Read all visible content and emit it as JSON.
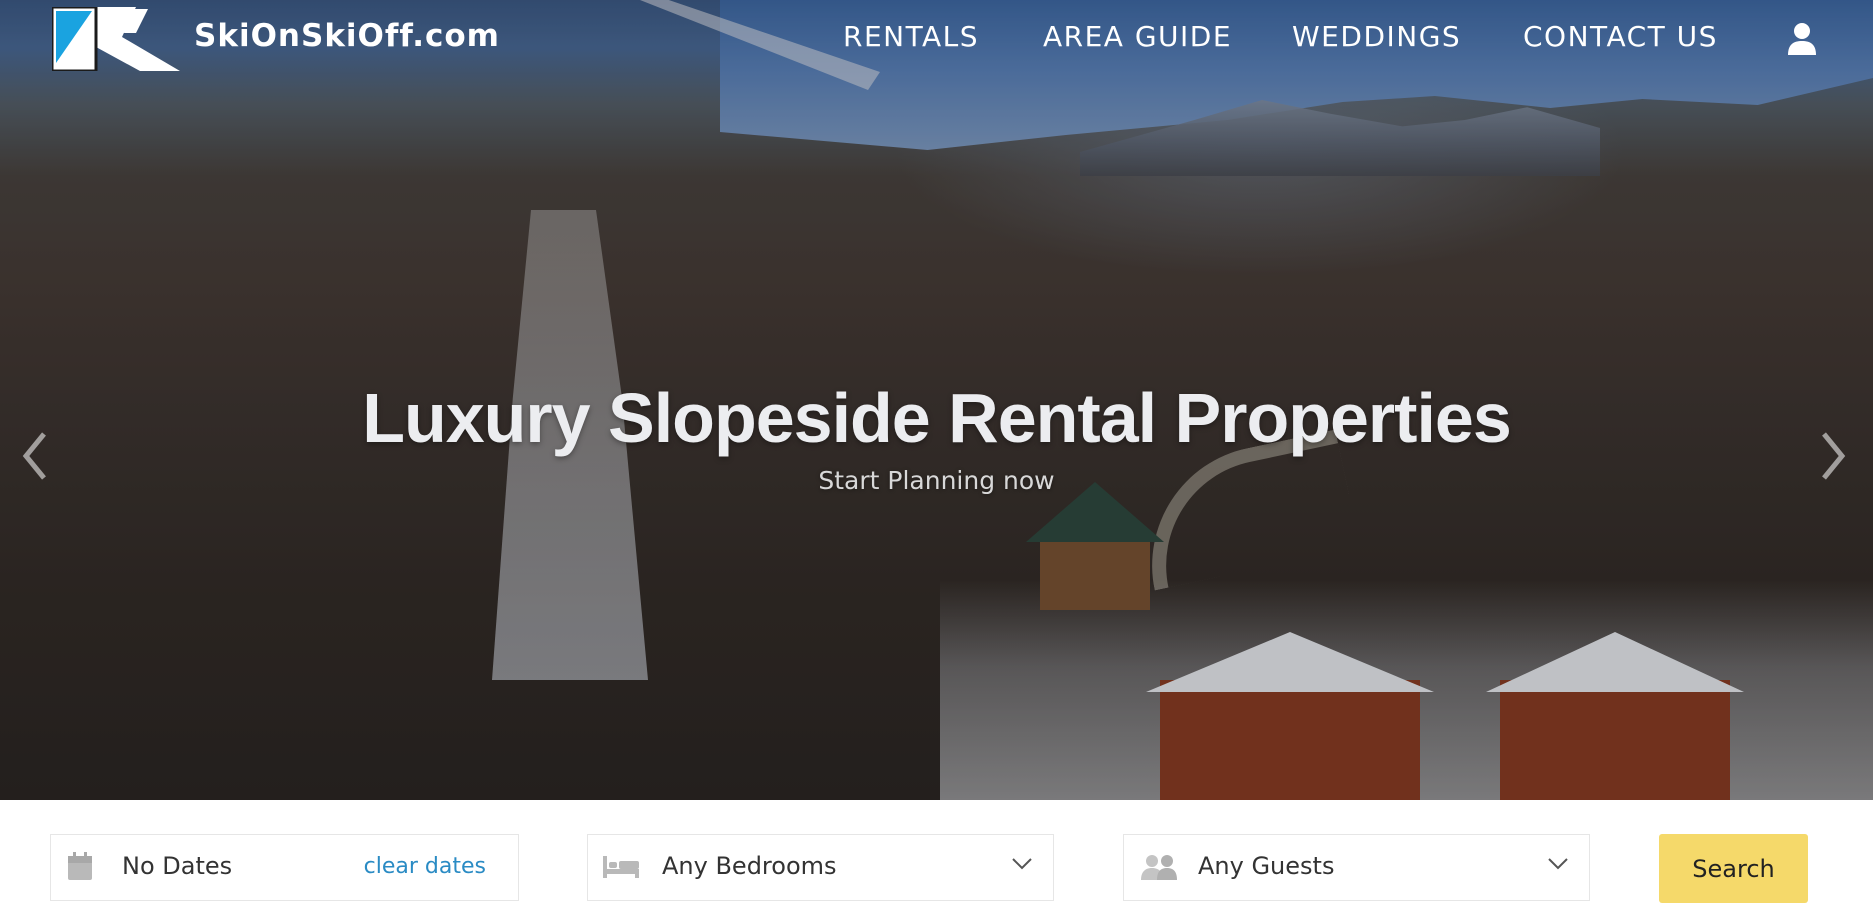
{
  "site": {
    "brand_name": "SkiOnSkiOff.com",
    "logo_icon": "ski-k-logo-icon",
    "brand_colors": {
      "logo_blue": "#1aa3e0",
      "accent_yellow": "#f5d96a",
      "link_blue": "#2a8bc4"
    }
  },
  "nav": {
    "items": [
      {
        "label": "RENTALS"
      },
      {
        "label": "AREA GUIDE"
      },
      {
        "label": "WEDDINGS"
      },
      {
        "label": "CONTACT US"
      }
    ],
    "account_icon": "user-icon"
  },
  "hero": {
    "title": "Luxury Slopeside Rental Properties",
    "subtitle": "Start Planning now",
    "prev_icon": "chevron-left-icon",
    "next_icon": "chevron-right-icon"
  },
  "search": {
    "dates": {
      "icon": "calendar-icon",
      "value": "No Dates",
      "clear_label": "clear dates"
    },
    "bedrooms": {
      "icon": "bed-icon",
      "value": "Any Bedrooms"
    },
    "guests": {
      "icon": "users-icon",
      "value": "Any Guests"
    },
    "submit_label": "Search"
  }
}
